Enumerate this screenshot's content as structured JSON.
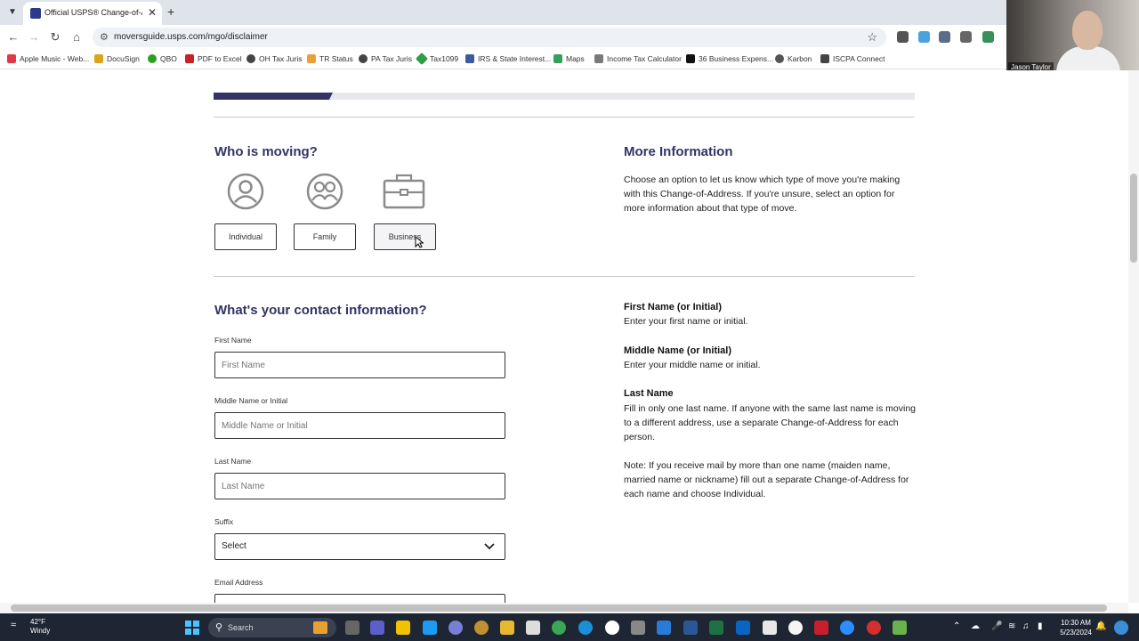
{
  "browser": {
    "tab_title": "Official USPS® Change-of-Add",
    "url": "moversguide.usps.com/mgo/disclaimer",
    "bookmarks": [
      "Apple Music - Web...",
      "DocuSign",
      "QBO",
      "PDF to Excel",
      "OH Tax Juris",
      "TR Status",
      "PA Tax Juris",
      "Tax1099",
      "IRS & State Interest...",
      "Maps",
      "Income Tax Calculator",
      "36 Business Expens...",
      "Karbon",
      "ISCPA Connect"
    ]
  },
  "webcam": {
    "name": "Jason Taylor"
  },
  "progress": {
    "fraction": 0.17
  },
  "moving": {
    "heading": "Who is moving?",
    "options": [
      {
        "label": "Individual",
        "icon": "person-icon"
      },
      {
        "label": "Family",
        "icon": "family-icon"
      },
      {
        "label": "Business",
        "icon": "briefcase-icon"
      }
    ]
  },
  "more_info": {
    "heading": "More Information",
    "text": "Choose an option to let us know which type of move you're making with this Change-of-Address. If you're unsure, select an option for more information about that type of move."
  },
  "contact": {
    "heading": "What's your contact information?",
    "fields": [
      {
        "label": "First Name",
        "placeholder": "First Name"
      },
      {
        "label": "Middle Name or Initial",
        "placeholder": "Middle Name or Initial"
      },
      {
        "label": "Last Name",
        "placeholder": "Last Name"
      }
    ],
    "suffix_label": "Suffix",
    "suffix_value": "Select",
    "email_label": "Email Address"
  },
  "help": {
    "first_title": "First Name (or Initial)",
    "first_text": "Enter your first name or initial.",
    "middle_title": "Middle Name (or Initial)",
    "middle_text": "Enter your middle name or initial.",
    "last_title": "Last Name",
    "last_text": "Fill in only one last name. If anyone with the same last name is moving to a different address, use a separate Change-of-Address for each person.",
    "note_text": "Note: If you receive mail by more than one name (maiden name, married name or nickname) fill out a separate Change-of-Address for each name and choose Individual."
  },
  "taskbar": {
    "temp": "42°F",
    "condition": "Windy",
    "search": "Search",
    "time": "10:30 AM",
    "date": "5/23/2024"
  }
}
